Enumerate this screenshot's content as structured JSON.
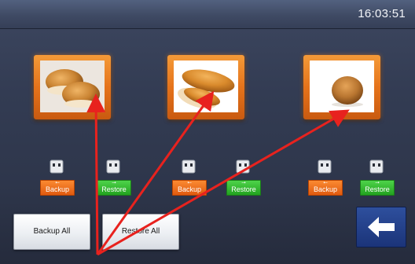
{
  "status_bar": {
    "time": "16:03:51"
  },
  "items": [
    {
      "name": "item-1",
      "backup_label": "Backup",
      "restore_label": "Restore"
    },
    {
      "name": "item-2",
      "backup_label": "Backup",
      "restore_label": "Restore"
    },
    {
      "name": "item-3",
      "backup_label": "Backup",
      "restore_label": "Restore"
    }
  ],
  "footer": {
    "backup_all_label": "Backup All",
    "restore_all_label": "Restore All",
    "back_icon": "arrow-left-icon"
  },
  "colors": {
    "tile_frame": "#e5731b",
    "backup": "#f07a22",
    "restore": "#35b832",
    "back_button": "#23418a",
    "annotation_arrows": "#e8221e"
  }
}
